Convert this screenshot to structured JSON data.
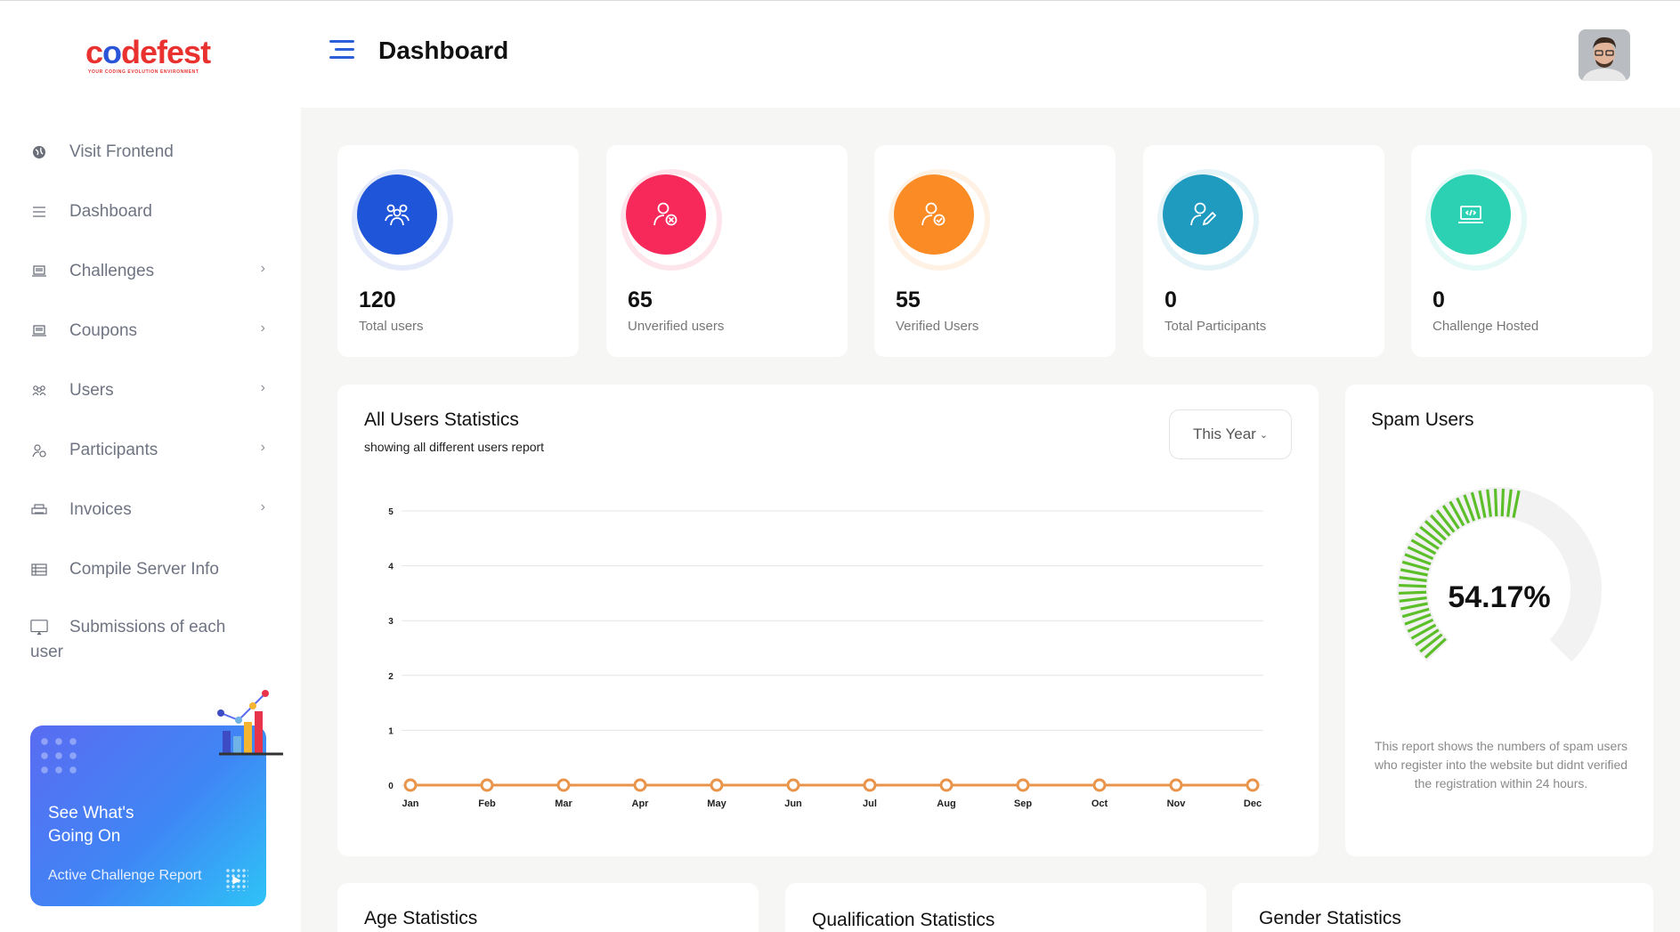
{
  "brand": {
    "logo_text_a": "c",
    "logo_text_o": "o",
    "logo_text_b": "defest",
    "tagline": "YOUR CODING EVOLUTION ENVIRONMENT"
  },
  "header": {
    "title": "Dashboard"
  },
  "sidebar": {
    "items": [
      {
        "label": "Visit Frontend",
        "icon": "globe-icon",
        "has_children": false
      },
      {
        "label": "Dashboard",
        "icon": "menu-lines-icon",
        "has_children": false
      },
      {
        "label": "Challenges",
        "icon": "laptop-icon",
        "has_children": true
      },
      {
        "label": "Coupons",
        "icon": "laptop-icon",
        "has_children": true
      },
      {
        "label": "Users",
        "icon": "users-group-icon",
        "has_children": true
      },
      {
        "label": "Participants",
        "icon": "participants-icon",
        "has_children": true
      },
      {
        "label": "Invoices",
        "icon": "printer-icon",
        "has_children": true
      },
      {
        "label": "Compile Server Info",
        "icon": "server-list-icon",
        "has_children": false
      },
      {
        "label": "Submissions of each user",
        "icon": "monitor-icon",
        "has_children": false
      }
    ],
    "promo": {
      "title": "See What's Going On",
      "link": "Active Challenge Report"
    }
  },
  "stats": [
    {
      "value": "120",
      "label": "Total users",
      "color": "#1f55d9",
      "icon": "users-group-icon"
    },
    {
      "value": "65",
      "label": "Unverified users",
      "color": "#f7295a",
      "icon": "user-x-icon"
    },
    {
      "value": "55",
      "label": "Verified Users",
      "color": "#fb8b25",
      "icon": "user-check-icon"
    },
    {
      "value": "0",
      "label": "Total Participants",
      "color": "#1f9bc0",
      "icon": "user-edit-icon"
    },
    {
      "value": "0",
      "label": "Challenge Hosted",
      "color": "#2bd1b2",
      "icon": "code-laptop-icon"
    }
  ],
  "users_chart": {
    "title": "All Users Statistics",
    "subtitle": "showing all different users report",
    "period": "This Year",
    "chart_data": {
      "type": "line",
      "categories": [
        "Jan",
        "Feb",
        "Mar",
        "Apr",
        "May",
        "Jun",
        "Jul",
        "Aug",
        "Sep",
        "Oct",
        "Nov",
        "Dec"
      ],
      "series": [
        {
          "values": [
            0,
            0,
            0,
            0,
            0,
            0,
            0,
            0,
            0,
            0,
            0,
            0
          ],
          "color": "#e8944a"
        }
      ],
      "y_ticks": [
        "0",
        "1",
        "2",
        "3",
        "4",
        "5"
      ],
      "ylim": [
        0,
        5
      ],
      "grid": true
    }
  },
  "spam": {
    "title": "Spam Users",
    "percent": 54.17,
    "percent_text": "54.17%",
    "description": "This report shows the numbers of spam users who register into the website but didnt verified the registration within 24 hours."
  },
  "bottom_cards": [
    {
      "title": "Age Statistics"
    },
    {
      "title": "Qualification Statistics"
    },
    {
      "title": "Gender Statistics"
    }
  ]
}
